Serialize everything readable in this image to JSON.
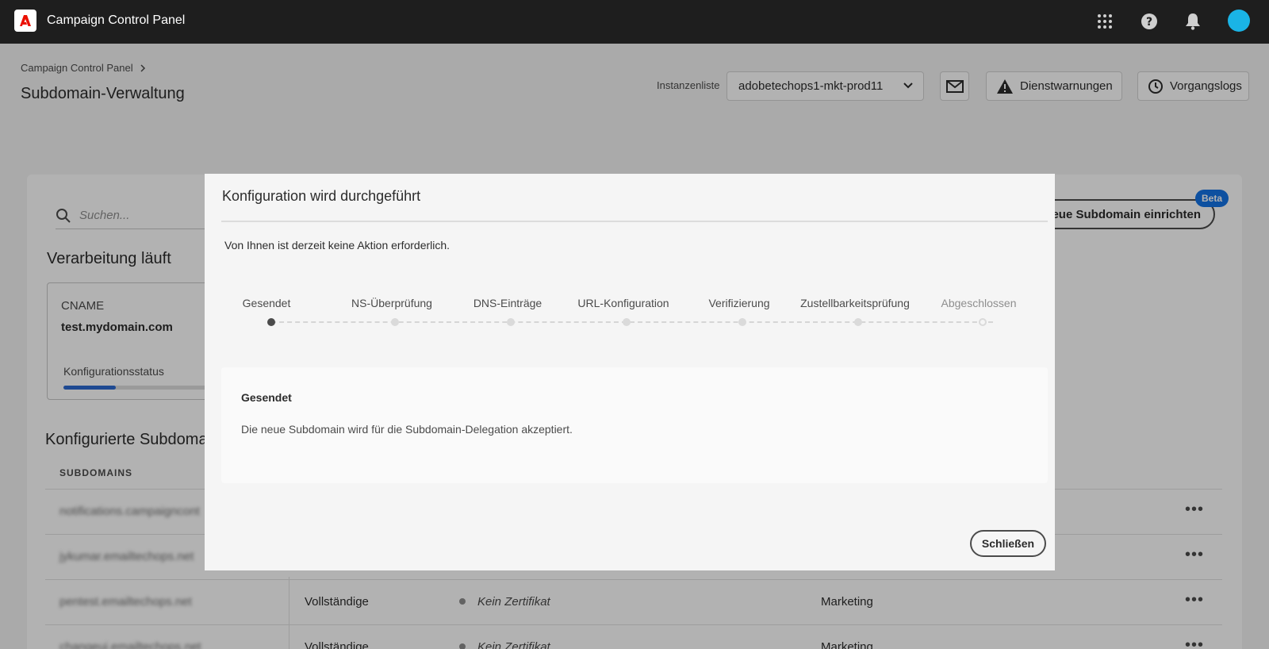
{
  "app": {
    "title": "Campaign Control Panel"
  },
  "header": {
    "breadcrumb": "Campaign Control Panel",
    "page_title": "Subdomain-Verwaltung",
    "instance_label": "Instanzenliste",
    "instance_value": "adobetechops1-mkt-prod11",
    "alerts_label": "Dienstwarnungen",
    "logs_label": "Vorgangslogs"
  },
  "background": {
    "search_placeholder": "Suchen...",
    "new_subdomain_label": "eue Subdomain einrichten",
    "beta_badge": "Beta",
    "processing_title": "Verarbeitung läuft",
    "processing_card": {
      "type_label": "CNAME",
      "domain": "test.mydomain.com",
      "status_label": "Konfigurationsstatus",
      "progress": 0.33
    },
    "configured_title": "Konfigurierte Subdoma",
    "column_subdomains": "SUBDOMAINS",
    "rows": [
      {
        "subdomain": "notifications.campaigncont",
        "type": "",
        "cert": "",
        "use": "",
        "more": "•••"
      },
      {
        "subdomain": "jykumar.emailtechops.net",
        "type": "",
        "cert": "",
        "use": "",
        "more": "•••"
      },
      {
        "subdomain": "pentest.emailtechops.net",
        "type": "Vollständige",
        "cert": "Kein Zertifikat",
        "use": "Marketing",
        "more": "•••"
      },
      {
        "subdomain": "changeui.emailtechops.net",
        "type": "Vollständige",
        "cert": "Kein Zertifikat",
        "use": "Marketing",
        "more": "•••"
      }
    ]
  },
  "modal": {
    "title": "Konfiguration wird durchgeführt",
    "info": "Von Ihnen ist derzeit keine Aktion erforderlich.",
    "steps": [
      {
        "label": "Gesendet"
      },
      {
        "label": "NS-Überprüfung"
      },
      {
        "label": "DNS-Einträge"
      },
      {
        "label": "URL-Konfiguration"
      },
      {
        "label": "Verifizierung"
      },
      {
        "label": "Zustellbarkeitsprüfung"
      },
      {
        "label": "Abgeschlossen"
      }
    ],
    "detail_title": "Gesendet",
    "detail_text": "Die neue Subdomain wird für die Subdomain-Delegation akzeptiert.",
    "close_label": "Schließen"
  },
  "colors": {
    "accent": "#1473e6",
    "topbar": "#1e1e1e",
    "avatar": "#1ab4e6",
    "logo_red": "#eb1000"
  }
}
